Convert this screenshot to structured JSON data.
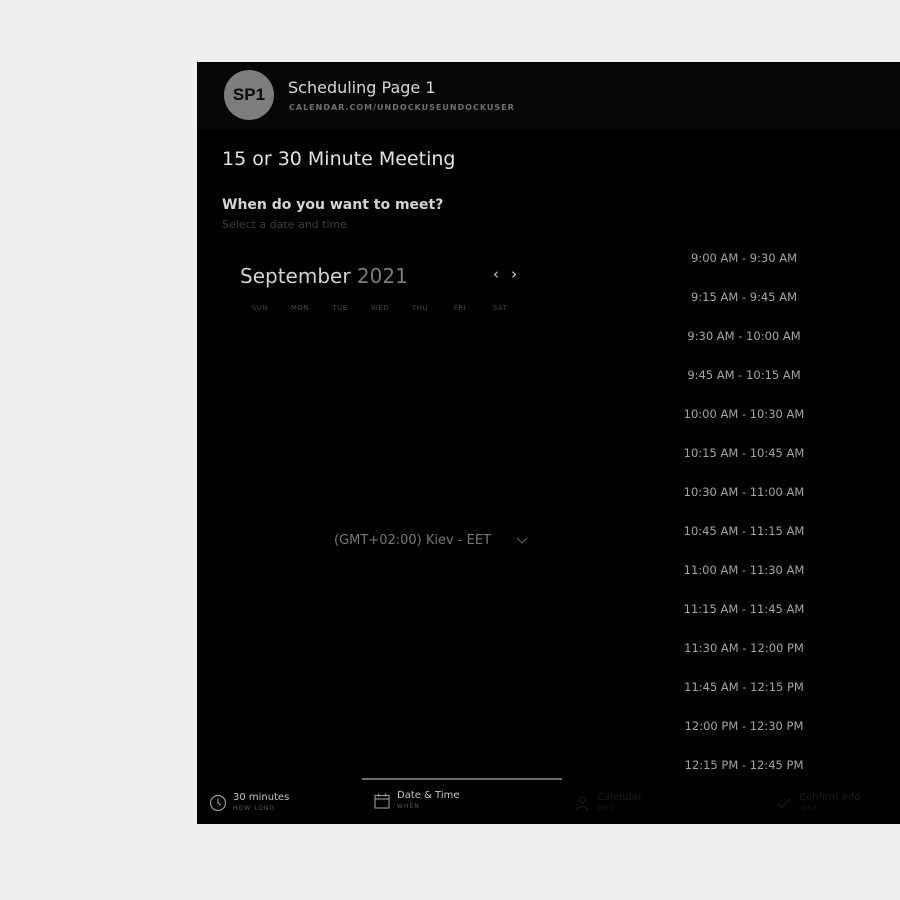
{
  "header": {
    "avatar_initials": "SP1",
    "title": "Scheduling Page 1",
    "url": "CALENDAR.COM/UNDOCKUSEUNDOCKUSER"
  },
  "meeting": {
    "title": "15 or 30 Minute Meeting",
    "question": "When do you want to meet?",
    "subtitle": "Select a date and time"
  },
  "calendar": {
    "month": "September",
    "year": "2021",
    "prev_icon": "chevron-left-icon",
    "next_icon": "chevron-right-icon",
    "weekdays": [
      "SUN",
      "MON",
      "TUE",
      "WED",
      "THU",
      "FRI",
      "SAT"
    ]
  },
  "timezone": {
    "value": "(GMT+02:00) Kiev - EET",
    "icon": "chevron-down-icon"
  },
  "slots": [
    "9:00 AM - 9:30 AM",
    "9:15 AM - 9:45 AM",
    "9:30 AM - 10:00 AM",
    "9:45 AM - 10:15 AM",
    "10:00 AM - 10:30 AM",
    "10:15 AM - 10:45 AM",
    "10:30 AM - 11:00 AM",
    "10:45 AM - 11:15 AM",
    "11:00 AM - 11:30 AM",
    "11:15 AM - 11:45 AM",
    "11:30 AM - 12:00 PM",
    "11:45 AM - 12:15 PM",
    "12:00 PM - 12:30 PM",
    "12:15 PM - 12:45 PM"
  ],
  "footer": {
    "steps": [
      {
        "label": "30 minutes",
        "sub": "HOW LONG",
        "icon": "clock-icon"
      },
      {
        "label": "Date & Time",
        "sub": "WHEN",
        "icon": "calendar-icon"
      },
      {
        "label": "Calendar",
        "sub": "WHO",
        "icon": "person-icon"
      },
      {
        "label": "Confirm Info",
        "sub": "INFO",
        "icon": "check-icon"
      }
    ]
  }
}
